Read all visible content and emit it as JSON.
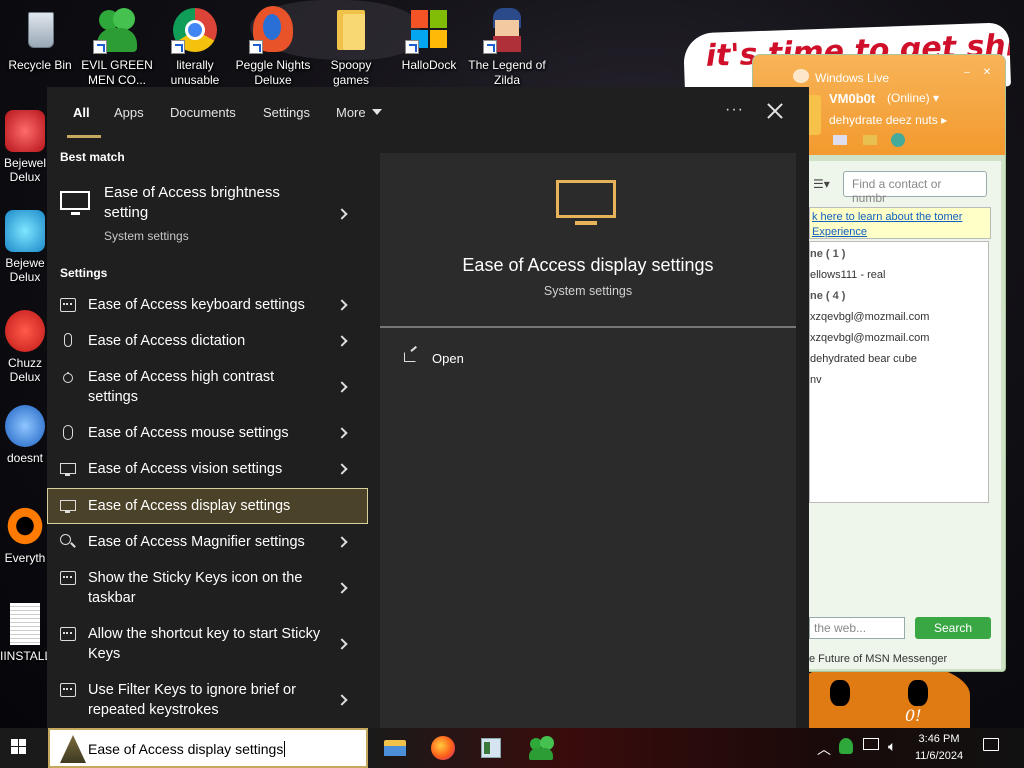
{
  "desktop": {
    "icons": [
      {
        "label": "Recycle Bin",
        "icon": "recycle-bin-icon"
      },
      {
        "label": "EVIL GREEN MEN CO...",
        "icon": "evil-green-men-icon"
      },
      {
        "label": "literally unusable",
        "icon": "chrome-icon"
      },
      {
        "label": "Peggle Nights Deluxe",
        "icon": "peggle-icon"
      },
      {
        "label": "Spoopy games",
        "icon": "folder-icon"
      },
      {
        "label": "HalloDock",
        "icon": "windows-logo-icon"
      },
      {
        "label": "The Legend of Zilda",
        "icon": "zilda-icon"
      }
    ],
    "partial_icons": [
      {
        "label": "Bejewel Delux",
        "icon": "bejeweled-icon"
      },
      {
        "label": "Bejewe Delux",
        "icon": "bejeweled-2-icon"
      },
      {
        "label": "Chuzz Delux",
        "icon": "chuzzle-icon"
      },
      {
        "label": "doesnt",
        "icon": "thunderbird-icon"
      },
      {
        "label": "Everyth",
        "icon": "everything-icon"
      },
      {
        "label": "IINSTALL",
        "icon": "text-file-icon"
      }
    ],
    "banner_text": "it's time to get shit",
    "wallpaper_mark": "0!"
  },
  "msn": {
    "title": "Windows Live",
    "name": "VM0b0t",
    "status": "(Online) ▾",
    "personal_message": "dehydrate deez nuts ▸",
    "find_placeholder": "Find a contact or numbr",
    "ad_text": "k here to learn about the tomer Experience",
    "groups": [
      {
        "label": "ne ( 1 )"
      },
      {
        "label": "ellows111 - real"
      },
      {
        "label": "ne ( 4 )"
      },
      {
        "label": "xzqevbgl@mozmail.com"
      },
      {
        "label": "xzqevbgl@mozmail.com"
      },
      {
        "label": "dehydrated bear cube"
      },
      {
        "label": "nv"
      }
    ],
    "web_search_placeholder": "the web...",
    "search_button": "Search",
    "footer": "e Future of MSN Messenger"
  },
  "search": {
    "tabs": [
      {
        "label": "All"
      },
      {
        "label": "Apps"
      },
      {
        "label": "Documents"
      },
      {
        "label": "Settings"
      },
      {
        "label": "More"
      }
    ],
    "ellipsis": "···",
    "best_match_heading": "Best match",
    "best_match": {
      "title": "Ease of Access brightness setting",
      "subtitle": "System settings",
      "icon": "monitor-icon"
    },
    "settings_heading": "Settings",
    "results": [
      {
        "label": "Ease of Access keyboard settings",
        "icon": "keyboard-icon"
      },
      {
        "label": "Ease of Access dictation",
        "icon": "microphone-icon"
      },
      {
        "label": "Ease of Access high contrast settings",
        "icon": "brightness-icon"
      },
      {
        "label": "Ease of Access mouse settings",
        "icon": "mouse-icon"
      },
      {
        "label": "Ease of Access vision settings",
        "icon": "monitor-icon"
      },
      {
        "label": "Ease of Access display settings",
        "icon": "monitor-icon",
        "selected": true
      },
      {
        "label": "Ease of Access Magnifier settings",
        "icon": "magnifier-icon"
      },
      {
        "label": "Show the Sticky Keys icon on the taskbar",
        "icon": "keyboard-icon"
      },
      {
        "label": "Allow the shortcut key to start Sticky Keys",
        "icon": "keyboard-icon"
      },
      {
        "label": "Use Filter Keys to ignore brief or repeated keystrokes",
        "icon": "keyboard-icon"
      }
    ],
    "preview": {
      "title": "Ease of Access display settings",
      "subtitle": "System settings",
      "action_open": "Open",
      "accent": "#e6b35a"
    },
    "query": "Ease of Access display settings"
  },
  "taskbar": {
    "apps": [
      "file-explorer-icon",
      "firefox-icon",
      "control-panel-icon",
      "msn-messenger-icon"
    ],
    "time": "3:46 PM",
    "date": "11/6/2024"
  },
  "colors": {
    "accent": "#c6a75e",
    "flyout_bg": "#1f1f1f",
    "preview_bg": "#2b2b2b",
    "selected_bg": "#4b4329"
  }
}
